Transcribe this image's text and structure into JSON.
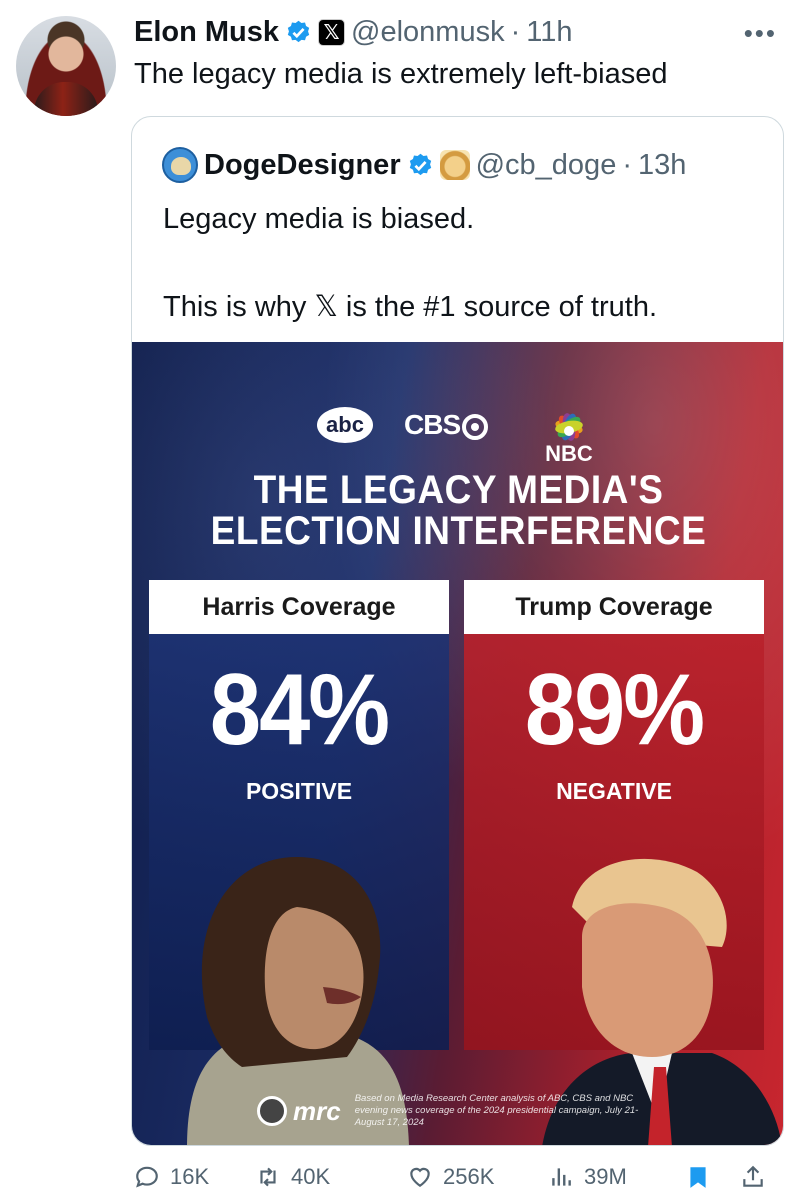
{
  "tweet": {
    "author_name": "Elon Musk",
    "handle": "@elonmusk",
    "separator": "·",
    "time": "11h",
    "text": "The legacy media is extremely left-biased",
    "more_icon": "more-horizontal-icon"
  },
  "quoted": {
    "author_name": "DogeDesigner",
    "handle": "@cb_doge",
    "separator": "·",
    "time": "13h",
    "text_line1": "Legacy media is biased.",
    "text_line2": "This is why 𝕏 is the #1 source of truth."
  },
  "graphic": {
    "logo_abc": "abc",
    "logo_cbs": "CBS",
    "logo_nbc": "NBC",
    "headline_line1": "THE LEGACY MEDIA'S",
    "headline_line2": "ELECTION INTERFERENCE",
    "left_label": "Harris Coverage",
    "left_value": "84%",
    "left_caption": "POSITIVE",
    "right_label": "Trump Coverage",
    "right_value": "89%",
    "right_caption": "NEGATIVE",
    "source_logo": "mrc",
    "source_note": "Based on Media Research Center analysis of ABC, CBS and NBC evening news coverage of the 2024 presidential campaign, July 21-August 17, 2024",
    "colors": {
      "blue": "#1c2d66",
      "red": "#c8262f"
    }
  },
  "actions": {
    "replies": "16K",
    "retweets": "40K",
    "likes": "256K",
    "views": "39M"
  },
  "colors": {
    "verified": "#1d9bf0",
    "bookmark": "#1d9bf0",
    "meta": "#536471"
  }
}
